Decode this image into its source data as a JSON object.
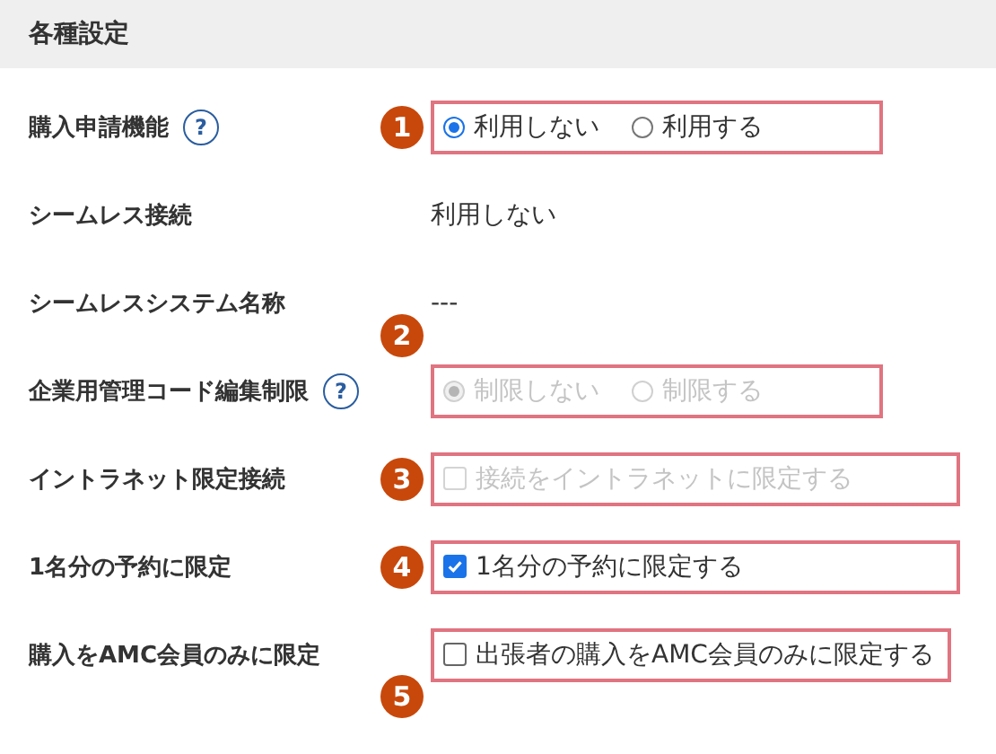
{
  "section": {
    "title": "各種設定"
  },
  "rows": [
    {
      "kind": "radio",
      "label": "購入申請機能",
      "help": "?",
      "callout": "1",
      "disabled": false,
      "options": [
        {
          "label": "利用しない",
          "selected": true
        },
        {
          "label": "利用する",
          "selected": false
        }
      ]
    },
    {
      "kind": "text",
      "label": "シームレス接続",
      "value": "利用しない"
    },
    {
      "kind": "text",
      "label": "シームレスシステム名称",
      "value": "---"
    },
    {
      "kind": "radio",
      "label": "企業用管理コード編集制限",
      "help": "?",
      "callout": "2",
      "disabled": true,
      "options": [
        {
          "label": "制限しない",
          "selected": true
        },
        {
          "label": "制限する",
          "selected": false
        }
      ]
    },
    {
      "kind": "checkbox",
      "label": "イントラネット限定接続",
      "callout": "3",
      "disabled": true,
      "option": {
        "label": "接続をイントラネットに限定する",
        "checked": false
      }
    },
    {
      "kind": "checkbox",
      "label": "1名分の予約に限定",
      "callout": "4",
      "disabled": false,
      "option": {
        "label": "1名分の予約に限定する",
        "checked": true
      }
    },
    {
      "kind": "checkbox",
      "label": "購入をAMC会員のみに限定",
      "callout": "5",
      "disabled": false,
      "option": {
        "label": "出張者の購入をAMC会員のみに限定する",
        "checked": false
      }
    }
  ]
}
